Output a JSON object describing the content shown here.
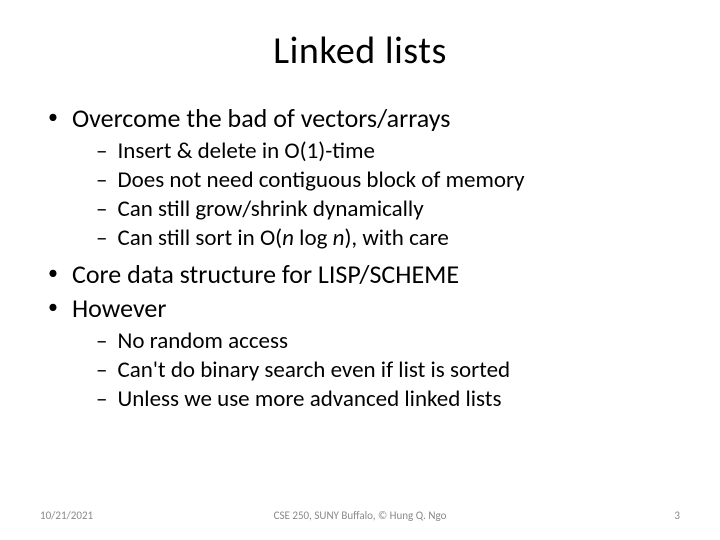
{
  "title": "Linked lists",
  "bullets": {
    "b1": "Overcome the bad of vectors/arrays",
    "b1_1": "Insert & delete in O(1)-time",
    "b1_2": "Does not need contiguous block of memory",
    "b1_3": "Can still grow/shrink dynamically",
    "b1_4a": "Can still sort in O(",
    "b1_4b": "n",
    "b1_4c": " log ",
    "b1_4d": "n",
    "b1_4e": "), with care",
    "b2": "Core data structure for LISP/SCHEME",
    "b3": "However",
    "b3_1": "No random access",
    "b3_2": "Can't do binary search even if list is sorted",
    "b3_3": "Unless we use more advanced linked lists"
  },
  "footer": {
    "date": "10/21/2021",
    "center": "CSE 250,  SUNY Buffalo, © Hung Q. Ngo",
    "page": "3"
  }
}
